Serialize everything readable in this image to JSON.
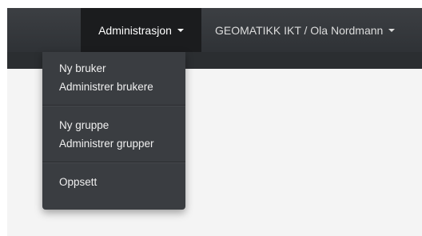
{
  "navbar": {
    "admin_menu_label": "Administrasjon",
    "user_menu_label": "GEOMATIKK IKT / Ola Nordmann"
  },
  "dropdown": {
    "groups": [
      {
        "items": [
          {
            "label": "Ny bruker"
          },
          {
            "label": "Administrer brukere"
          }
        ]
      },
      {
        "items": [
          {
            "label": "Ny gruppe"
          },
          {
            "label": "Administrer grupper"
          }
        ]
      },
      {
        "items": [
          {
            "label": "Oppsett"
          }
        ]
      }
    ]
  }
}
